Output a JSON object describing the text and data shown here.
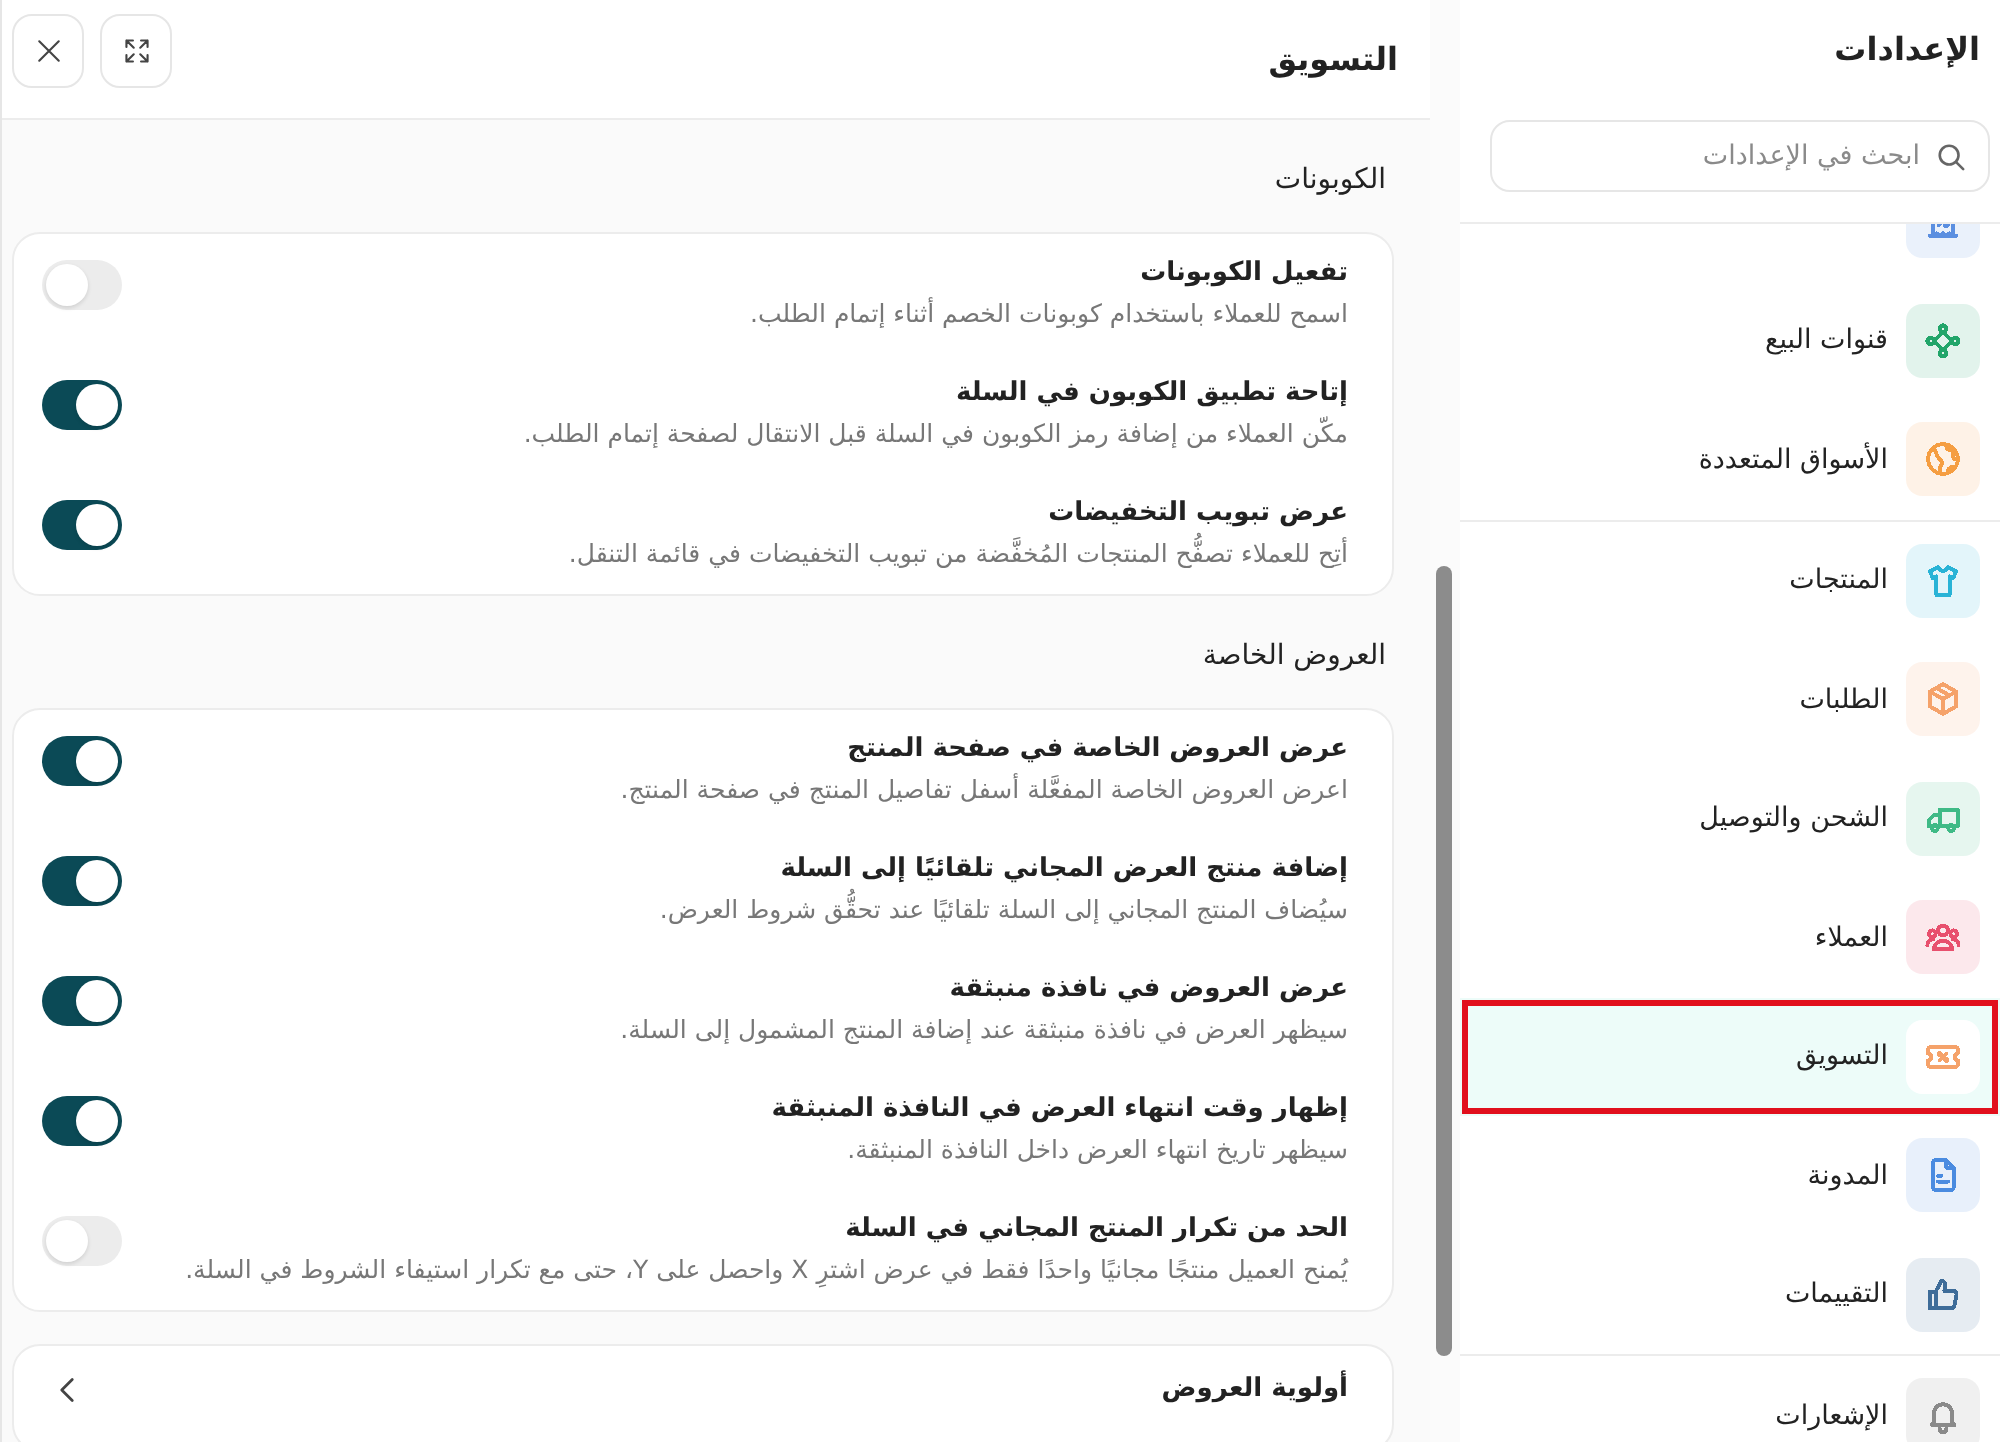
{
  "sidebar": {
    "title": "الإعدادات",
    "search": {
      "placeholder": "ابحث في الإعدادات"
    },
    "groups": [
      {
        "items": [
          {
            "color": "#5b8fe0",
            "selected": false,
            "outlined": false
          },
          {
            "label": "قنوات البيع",
            "color": "#22a56a",
            "selected": false,
            "outlined": false
          },
          {
            "label": "الأسواق المتعددة",
            "color": "#f59e42",
            "selected": false,
            "outlined": false
          }
        ]
      },
      {
        "items": [
          {
            "label": "المنتجات",
            "color": "#29b3d6",
            "selected": false,
            "outlined": false
          },
          {
            "label": "الطلبات",
            "color": "#f5a26a",
            "selected": false,
            "outlined": false
          },
          {
            "label": "الشحن والتوصيل",
            "color": "#3fba86",
            "selected": false,
            "outlined": false
          },
          {
            "label": "العملاء",
            "color": "#e8506e",
            "selected": false,
            "outlined": false
          },
          {
            "label": "التسويق",
            "color": "#f5a26a",
            "selected": true,
            "outlined": true
          },
          {
            "label": "المدونة",
            "color": "#4a8be0",
            "selected": false,
            "outlined": false
          },
          {
            "label": "التقييمات",
            "color": "#3e6c99",
            "selected": false,
            "outlined": false
          }
        ]
      },
      {
        "items": [
          {
            "label": "الإشعارات",
            "color": "#8a8a8a",
            "selected": false,
            "outlined": false
          }
        ]
      }
    ]
  },
  "panel": {
    "title": "التسويق",
    "sections": [
      {
        "title": "الكوبونات",
        "settings": [
          {
            "title": "تفعيل الكوبونات",
            "description": "اسمح للعملاء باستخدام كوبونات الخصم أثناء إتمام الطلب.",
            "on": false
          },
          {
            "title": "إتاحة تطبيق الكوبون في السلة",
            "description": "مكّن العملاء من إضافة رمز الكوبون في السلة قبل الانتقال لصفحة إتمام الطلب.",
            "on": true
          },
          {
            "title": "عرض تبويب التخفيضات",
            "description": "أتِح للعملاء تصفُّح المنتجات المُخفَّضة من تبويب التخفيضات في قائمة التنقل.",
            "on": true
          }
        ]
      },
      {
        "title": "العروض الخاصة",
        "settings": [
          {
            "title": "عرض العروض الخاصة في صفحة المنتج",
            "description": "اعرض العروض الخاصة المفعَّلة أسفل تفاصيل المنتج في صفحة المنتج.",
            "on": true
          },
          {
            "title": "إضافة منتج العرض المجاني تلقائيًا إلى السلة",
            "description": "سيُضاف المنتج المجاني إلى السلة تلقائيًا عند تحقُّق شروط العرض.",
            "on": true
          },
          {
            "title": "عرض العروض في نافذة منبثقة",
            "description": "سيظهر العرض في نافذة منبثقة عند إضافة المنتج المشمول إلى السلة.",
            "on": true
          },
          {
            "title": "إظهار وقت انتهاء العرض في النافذة المنبثقة",
            "description": "سيظهر تاريخ انتهاء العرض داخل النافذة المنبثقة.",
            "on": true
          },
          {
            "title": "الحد من تكرار المنتج المجاني في السلة",
            "description": "يُمنح العميل منتجًا مجانيًا واحدًا فقط في عرض اشترِ X واحصل على Y، حتى مع تكرار استيفاء الشروط في السلة.",
            "on": false
          }
        ]
      }
    ],
    "links": [
      {
        "label": "أولوية العروض"
      }
    ]
  }
}
